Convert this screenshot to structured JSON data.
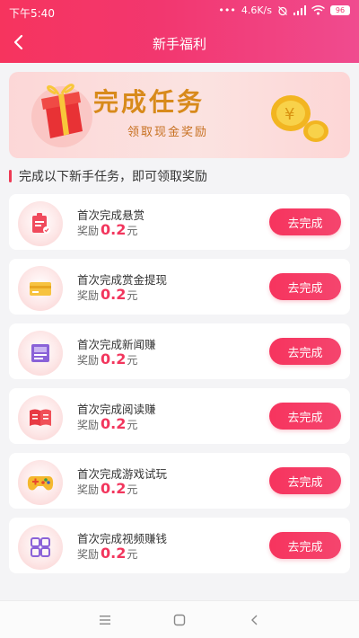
{
  "status_bar": {
    "time": "下午5:40",
    "dots": "•••",
    "network_speed": "4.6K/s",
    "battery": "96"
  },
  "nav": {
    "title": "新手福利"
  },
  "banner": {
    "title": "完成任务",
    "subtitle": "领取现金奖励"
  },
  "section": {
    "title": "完成以下新手任务，即可领取奖励"
  },
  "tasks": [
    {
      "title": "首次完成悬赏",
      "reward_label": "奖励",
      "amount": "0.2",
      "unit": "元",
      "button": "去完成",
      "icon": "clipboard-icon"
    },
    {
      "title": "首次完成赏金提现",
      "reward_label": "奖励",
      "amount": "0.2",
      "unit": "元",
      "button": "去完成",
      "icon": "card-icon"
    },
    {
      "title": "首次完成新闻赚",
      "reward_label": "奖励",
      "amount": "0.2",
      "unit": "元",
      "button": "去完成",
      "icon": "news-icon"
    },
    {
      "title": "首次完成阅读赚",
      "reward_label": "奖励",
      "amount": "0.2",
      "unit": "元",
      "button": "去完成",
      "icon": "book-icon"
    },
    {
      "title": "首次完成游戏试玩",
      "reward_label": "奖励",
      "amount": "0.2",
      "unit": "元",
      "button": "去完成",
      "icon": "gamepad-icon"
    },
    {
      "title": "首次完成视频赚钱",
      "reward_label": "奖励",
      "amount": "0.2",
      "unit": "元",
      "button": "去完成",
      "icon": "grid-apps-icon"
    }
  ],
  "colors": {
    "accent": "#f2365d",
    "header_gradient_start": "#f6345e",
    "header_gradient_end": "#f04b8f",
    "banner_title": "#d88a1b"
  }
}
